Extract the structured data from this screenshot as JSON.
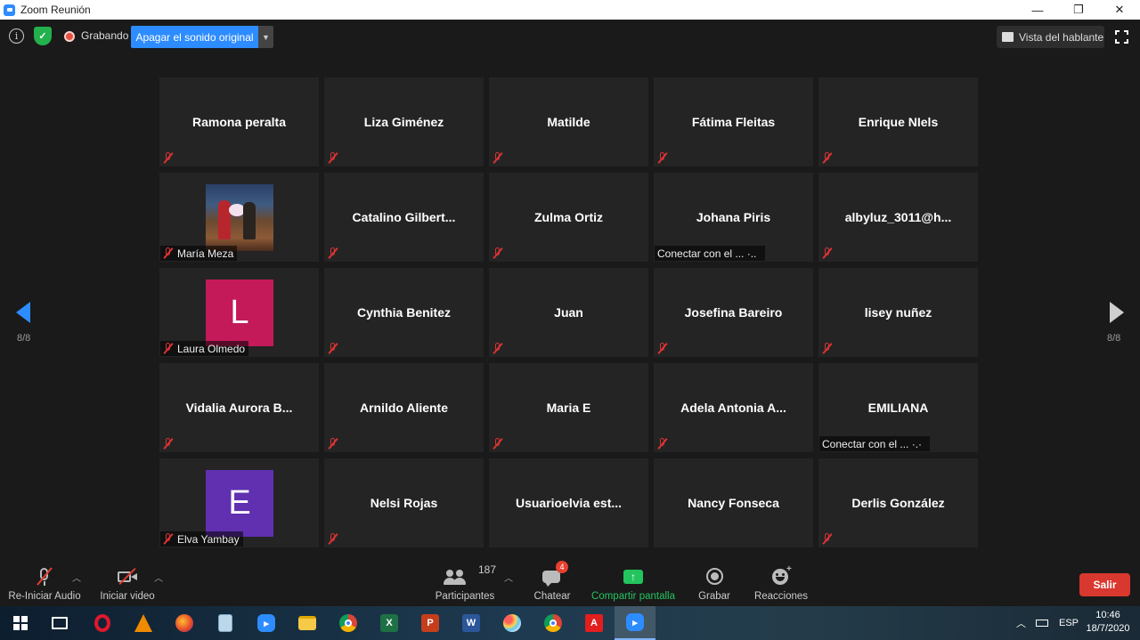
{
  "window": {
    "title": "Zoom Reunión",
    "minimize": "—",
    "maximize": "❐",
    "close": "✕"
  },
  "topbar": {
    "recording_label": "Grabando",
    "original_sound_button": "Apagar el sonido original",
    "speaker_view_button": "Vista del hablante"
  },
  "participants": [
    {
      "name": "Ramona peralta",
      "muted": true,
      "type": "name"
    },
    {
      "name": "Liza Giménez",
      "muted": true,
      "type": "name"
    },
    {
      "name": "Matilde",
      "muted": true,
      "type": "name"
    },
    {
      "name": "Fátima Fleitas",
      "muted": true,
      "type": "name"
    },
    {
      "name": "Enrique NIels",
      "muted": true,
      "type": "name"
    },
    {
      "name": "María Meza",
      "muted": true,
      "type": "photo"
    },
    {
      "name": "Catalino  Gilbert...",
      "muted": true,
      "type": "name"
    },
    {
      "name": "Zulma Ortiz",
      "muted": true,
      "type": "name"
    },
    {
      "name": "Johana Piris",
      "muted": false,
      "type": "name",
      "status": "Conectar con el ...  ·.."
    },
    {
      "name": "albyluz_3011@h...",
      "muted": true,
      "type": "name"
    },
    {
      "name": "Laura Olmedo",
      "muted": true,
      "type": "avatar",
      "letter": "L",
      "color": "#c41a5a"
    },
    {
      "name": "Cynthia Benitez",
      "muted": true,
      "type": "name"
    },
    {
      "name": "Juan",
      "muted": true,
      "type": "name"
    },
    {
      "name": "Josefina Bareiro",
      "muted": true,
      "type": "name"
    },
    {
      "name": "lisey nuñez",
      "muted": true,
      "type": "name"
    },
    {
      "name": "Vidalia  Aurora  B...",
      "muted": true,
      "type": "name"
    },
    {
      "name": "Arnildo Aliente",
      "muted": true,
      "type": "name"
    },
    {
      "name": "Maria E",
      "muted": true,
      "type": "name"
    },
    {
      "name": "Adela  Antonia  A...",
      "muted": true,
      "type": "name"
    },
    {
      "name": "EMILIANA",
      "muted": false,
      "type": "name",
      "status": "Conectar con el ...  ·.·"
    },
    {
      "name": "Elva Yambay",
      "muted": true,
      "type": "avatar",
      "letter": "E",
      "color": "#6030b0"
    },
    {
      "name": "Nelsi  Rojas",
      "muted": true,
      "type": "name"
    },
    {
      "name": "Usuarioelvia  est...",
      "muted": false,
      "type": "name"
    },
    {
      "name": "Nancy Fonseca",
      "muted": false,
      "type": "name"
    },
    {
      "name": "Derlis González",
      "muted": true,
      "type": "name"
    }
  ],
  "pagination": {
    "left": "8/8",
    "right": "8/8"
  },
  "toolbar": {
    "audio_label": "Re-Iniciar Audio",
    "video_label": "Iniciar video",
    "participants_label": "Participantes",
    "participants_count": "187",
    "chat_label": "Chatear",
    "chat_badge": "4",
    "share_label": "Compartir pantalla",
    "record_label": "Grabar",
    "reactions_label": "Reacciones",
    "leave_label": "Salir"
  },
  "taskbar": {
    "apps": [
      "windows-start",
      "task-view",
      "opera",
      "vlc",
      "firefox",
      "notepad",
      "zoom",
      "file-explorer",
      "chrome",
      "excel",
      "powerpoint",
      "word",
      "paint",
      "chrome-alt",
      "acrobat",
      "zoom-active"
    ],
    "language": "ESP",
    "time": "10:46",
    "date": "18/7/2020"
  },
  "colors": {
    "accent": "#2d8cff",
    "leave": "#d9382e",
    "share": "#23c45e",
    "muted": "#dd3333"
  }
}
